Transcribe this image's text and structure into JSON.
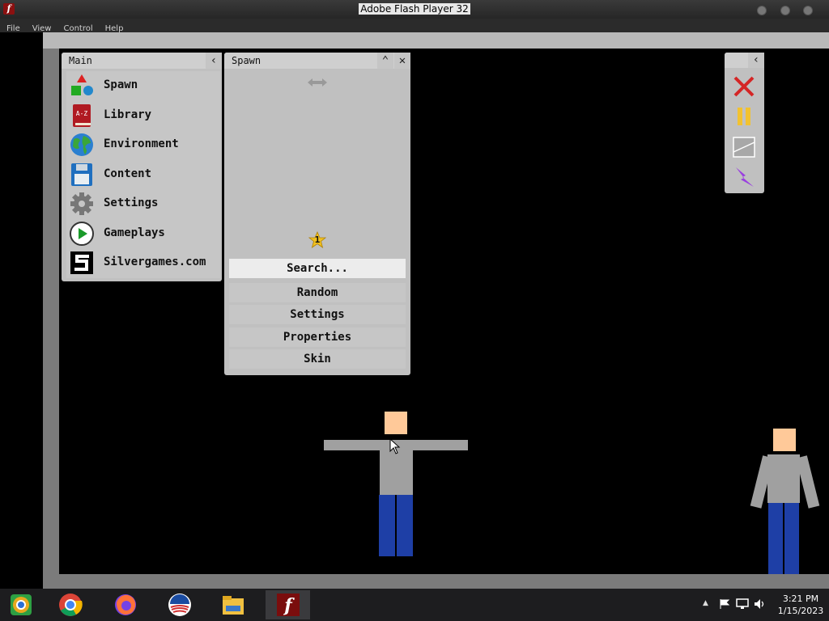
{
  "window": {
    "title": "Adobe Flash Player 32"
  },
  "menu": {
    "items": [
      "File",
      "View",
      "Control",
      "Help"
    ]
  },
  "main_panel": {
    "title": "Main",
    "items": [
      {
        "label": "Spawn",
        "icon": "shapes-icon"
      },
      {
        "label": "Library",
        "icon": "library-book-icon"
      },
      {
        "label": "Environment",
        "icon": "globe-icon"
      },
      {
        "label": "Content",
        "icon": "floppy-disk-icon"
      },
      {
        "label": "Settings",
        "icon": "gear-icon"
      },
      {
        "label": "Gameplays",
        "icon": "play-icon"
      },
      {
        "label": "Silvergames.com",
        "icon": "silvergames-logo-icon"
      }
    ]
  },
  "spawn_panel": {
    "title": "Spawn",
    "selected_count": "1",
    "search_label": "Search...",
    "buttons": [
      "Random",
      "Settings",
      "Properties",
      "Skin"
    ]
  },
  "toolbar": {
    "icons": [
      "close-x-icon",
      "pause-icon",
      "slope-icon",
      "lightning-icon"
    ]
  },
  "taskbar": {
    "apps": [
      "chrome-canary-icon",
      "chrome-icon",
      "firefox-icon",
      "obama-logo-icon",
      "file-explorer-icon",
      "flash-player-icon"
    ],
    "time": "3:21 PM",
    "date": "1/15/2023"
  },
  "colors": {
    "skin": "#ffc999",
    "shirt": "#a0a0a0",
    "pants": "#1e3fa6",
    "panel": "#c0c0c0"
  }
}
